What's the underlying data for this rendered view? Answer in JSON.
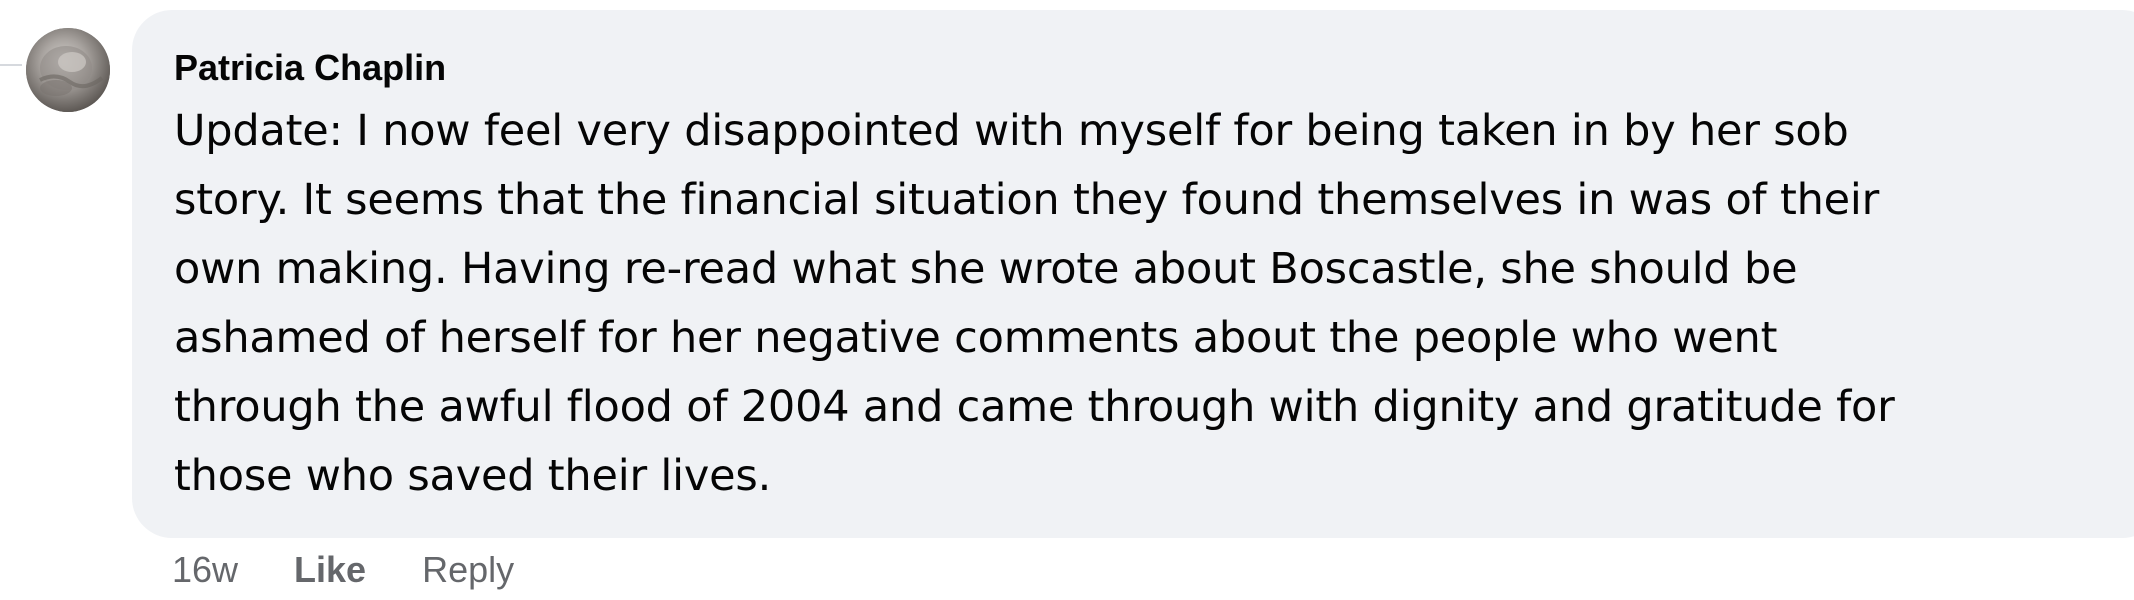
{
  "comment": {
    "author": "Patricia Chaplin",
    "avatar_icon": "user-avatar-photo",
    "text_lines": [
      "Update: I now feel very disappointed with myself for being taken in by her sob",
      "story. It seems that the financial situation they found themselves in was of their",
      "own making. Having re-read what she wrote about Boscastle, she should be",
      "ashamed of herself for her negative comments about the people who went",
      "through the awful flood of 2004 and came through with dignity and gratitude for",
      "those who saved their lives."
    ],
    "bubble_color": "#f0f2f5"
  },
  "actions": {
    "timestamp": "16w",
    "like_label": "Like",
    "reply_label": "Reply",
    "muted_color": "#65676b"
  }
}
